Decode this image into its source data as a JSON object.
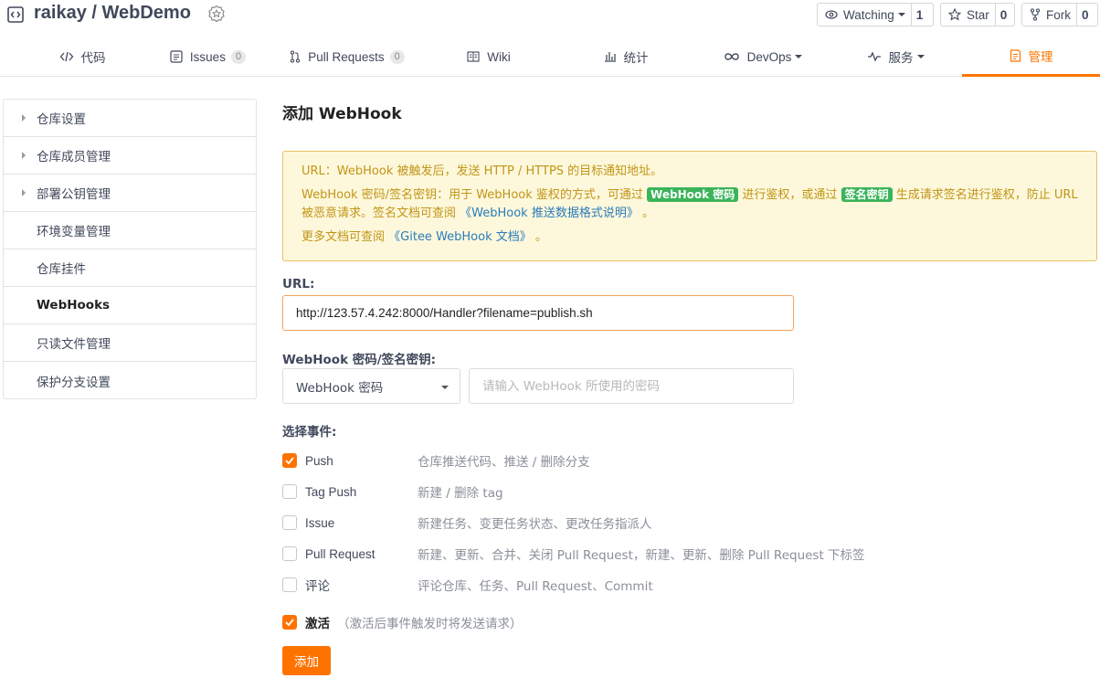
{
  "repo": {
    "title": "raikay / WebDemo"
  },
  "header_buttons": {
    "watching": {
      "label": "Watching",
      "count": "1"
    },
    "star": {
      "label": "Star",
      "count": "0"
    },
    "fork": {
      "label": "Fork",
      "count": "0"
    }
  },
  "tabs": [
    {
      "label": "代码",
      "icon": "code-icon"
    },
    {
      "label": "Issues",
      "count": "0",
      "icon": "issues-icon"
    },
    {
      "label": "Pull Requests",
      "count": "0",
      "icon": "pull-request-icon"
    },
    {
      "label": "Wiki",
      "icon": "book-icon"
    },
    {
      "label": "统计",
      "icon": "bar-chart-icon"
    },
    {
      "label": "DevOps",
      "icon": "infinity-icon"
    },
    {
      "label": "服务",
      "icon": "pulse-icon"
    },
    {
      "label": "管理",
      "icon": "manage-icon"
    }
  ],
  "sidebar": {
    "items": [
      {
        "label": "仓库设置"
      },
      {
        "label": "仓库成员管理"
      },
      {
        "label": "部署公钥管理"
      },
      {
        "label": "环境变量管理"
      },
      {
        "label": "仓库挂件"
      },
      {
        "label": "WebHooks"
      },
      {
        "label": "只读文件管理"
      },
      {
        "label": "保护分支设置"
      }
    ]
  },
  "page_title": "添加 WebHook",
  "notice": {
    "line1": "URL：WebHook 被触发后，发送 HTTP / HTTPS 的目标通知地址。",
    "line2_a": "WebHook 密码/签名密钥：用于 WebHook 鉴权的方式，可通过",
    "tag1": "WebHook 密码",
    "line2_b": "进行鉴权，或通过",
    "tag2": "签名密钥",
    "line2_c": "生成请求签名进行鉴权，防止 URL 被恶意请求。签名文档可查阅",
    "link1": "《WebHook 推送数据格式说明》",
    "line2_d": "。",
    "line3_a": "更多文档可查阅",
    "link2": "《Gitee WebHook 文档》",
    "line3_b": "。"
  },
  "form": {
    "url_label": "URL:",
    "url_value": "http://123.57.4.242:8000/Handler?filename=publish.sh",
    "secret_label": "WebHook 密码/签名密钥:",
    "secret_type": "WebHook 密码",
    "secret_placeholder": "请输入 WebHook 所使用的密码",
    "events_label": "选择事件:",
    "events": [
      {
        "name": "Push",
        "desc": "仓库推送代码、推送 / 删除分支",
        "checked": true
      },
      {
        "name": "Tag Push",
        "desc": "新建 / 删除 tag",
        "checked": false
      },
      {
        "name": "Issue",
        "desc": "新建任务、变更任务状态、更改任务指派人",
        "checked": false
      },
      {
        "name": "Pull Request",
        "desc": "新建、更新、合并、关闭 Pull Request，新建、更新、删除 Pull Request 下标签",
        "checked": false
      },
      {
        "name": "评论",
        "desc": "评论仓库、任务、Pull Request、Commit",
        "checked": false
      }
    ],
    "activate_label": "激活",
    "activate_desc": "（激活后事件触发时将发送请求）",
    "submit_label": "添加"
  },
  "colors": {
    "accent": "#fe7300",
    "notice_bg": "#fdf8dc",
    "tag_green": "#3bb45a"
  }
}
